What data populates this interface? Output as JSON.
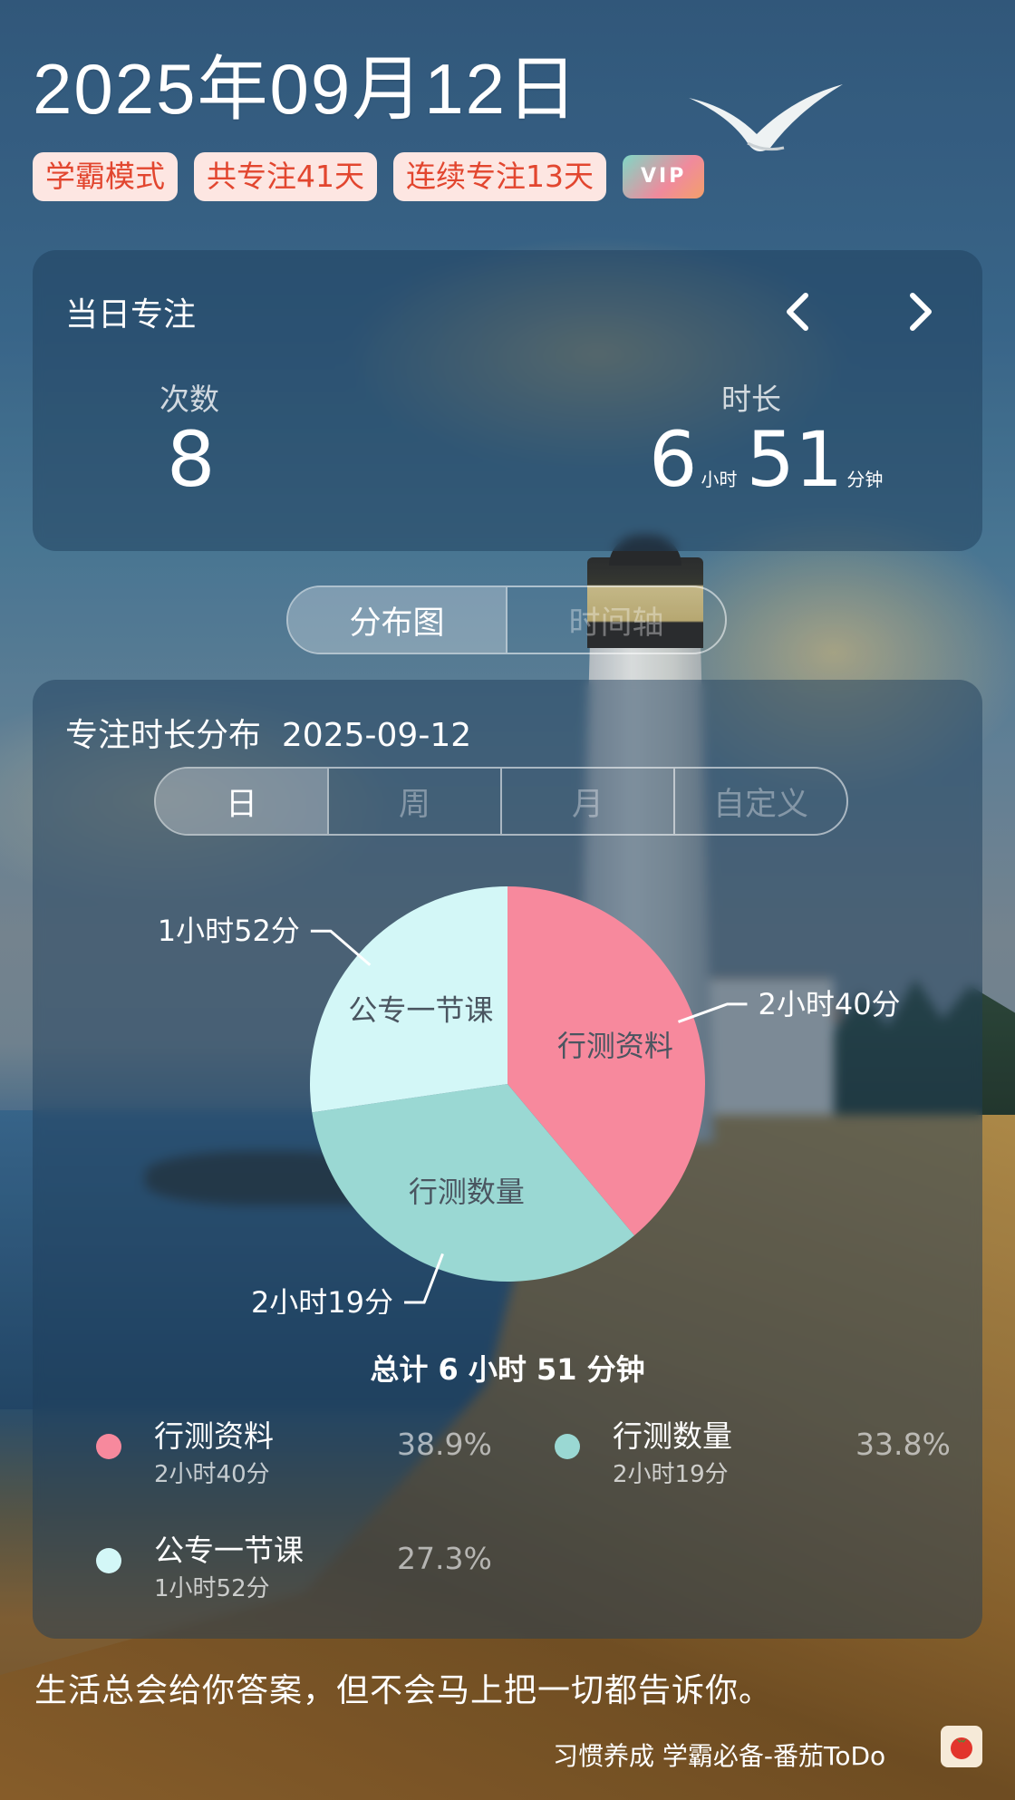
{
  "header": {
    "date": "2025年09月12日",
    "tags": [
      "学霸模式",
      "共专注41天",
      "连续专注13天"
    ],
    "vip": "VIP"
  },
  "daily": {
    "title": "当日专注",
    "count_label": "次数",
    "count_value": "8",
    "duration_label": "时长",
    "hours": "6",
    "hours_unit": "小时",
    "minutes": "51",
    "minutes_unit": "分钟",
    "prev_icon": "chevron-left-icon",
    "next_icon": "chevron-right-icon"
  },
  "view_tabs": [
    "分布图",
    "时间轴"
  ],
  "distribution": {
    "title": "专注时长分布",
    "date": "2025-09-12",
    "range_tabs": [
      "日",
      "周",
      "月",
      "自定义"
    ],
    "total": "总计 6 小时 51 分钟",
    "legend": [
      {
        "name": "行测资料",
        "duration": "2小时40分",
        "percent": "38.9%",
        "color": "#f7899d"
      },
      {
        "name": "行测数量",
        "duration": "2小时19分",
        "percent": "33.8%",
        "color": "#9ad8d3"
      },
      {
        "name": "公专一节课",
        "duration": "1小时52分",
        "percent": "27.3%",
        "color": "#d3f7f7"
      }
    ]
  },
  "chart_data": {
    "type": "pie",
    "categories": [
      "行测资料",
      "行测数量",
      "公专一节课"
    ],
    "values": [
      38.9,
      33.8,
      27.3
    ],
    "labels": [
      "2小时40分",
      "2小时19分",
      "1小时52分"
    ],
    "colors": [
      "#f7899d",
      "#9ad8d3",
      "#d3f7f7"
    ]
  },
  "footer": {
    "quote": "生活总会给你答案，但不会马上把一切都告诉你。",
    "brand": "习惯养成 学霸必备-番茄ToDo",
    "app_icon": "tomato-icon"
  }
}
